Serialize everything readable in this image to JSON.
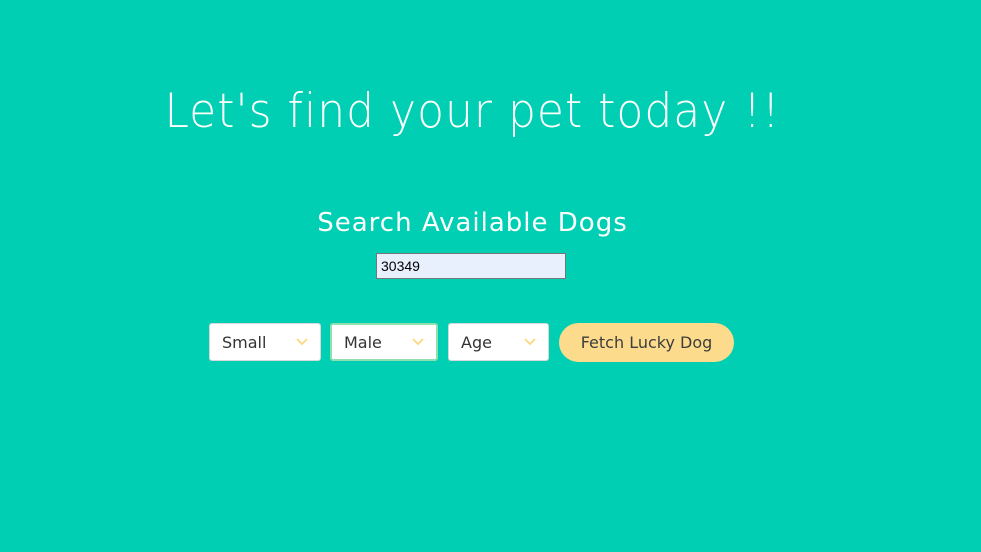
{
  "header": {
    "title": "Let's find your pet today !!"
  },
  "search": {
    "heading": "Search Available Dogs",
    "zip_value": "30349"
  },
  "filters": {
    "size": {
      "selected": "Small"
    },
    "gender": {
      "selected": "Male"
    },
    "age": {
      "selected": "Age"
    }
  },
  "actions": {
    "fetch_label": "Fetch Lucky Dog"
  },
  "colors": {
    "background": "#00cfb3",
    "accent": "#fcdc8c",
    "chevron": "#fcdc8c"
  },
  "icons": {
    "dropdown": "chevron-down-icon"
  }
}
